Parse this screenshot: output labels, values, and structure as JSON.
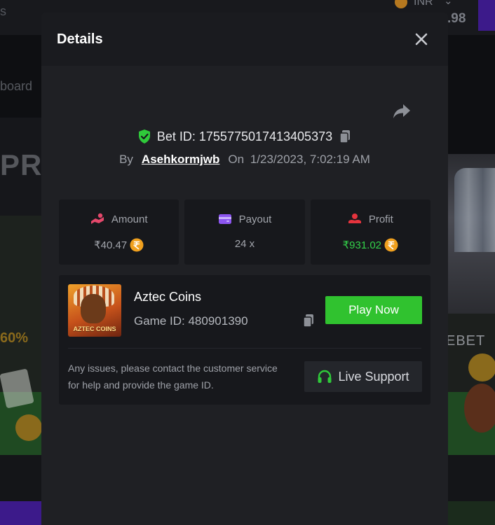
{
  "background": {
    "left_fragment": "s",
    "currency": "INR",
    "balance_fragment": ".98",
    "board_fragment": "board",
    "promo_fragment": "PR",
    "percent_fragment": "60%",
    "brand_fragment": "EBET"
  },
  "modal": {
    "title": "Details",
    "bet_id_label": "Bet ID: 1755775017413405373",
    "by_label": "By",
    "username": "Asehkormjwb",
    "on_label": "On",
    "datetime": "1/23/2023, 7:02:19 AM"
  },
  "stats": {
    "amount_label": "Amount",
    "amount_value": "₹40.47",
    "payout_label": "Payout",
    "payout_value": "24 x",
    "profit_label": "Profit",
    "profit_value": "₹931.02"
  },
  "game": {
    "name": "Aztec Coins",
    "id_label": "Game ID: 480901390",
    "thumb_text": "AZTEC COINS",
    "play_label": "Play Now",
    "help_text": "Any issues, please contact the customer service for help and provide the game ID.",
    "support_label": "Live Support"
  },
  "colors": {
    "accent_green": "#30c22f",
    "profit_green": "#33d14a",
    "modal_bg": "#1f2024",
    "card_bg": "#17181c",
    "amount_icon": "#e5486b",
    "payout_icon": "#8c55f0",
    "profit_icon": "#e5333d",
    "coin": "#f0a01e"
  },
  "icons": [
    "close-icon",
    "share-icon",
    "shield-check-icon",
    "copy-icon",
    "amount-icon",
    "wallet-icon",
    "profit-icon",
    "rupee-coin-icon",
    "headset-icon"
  ]
}
